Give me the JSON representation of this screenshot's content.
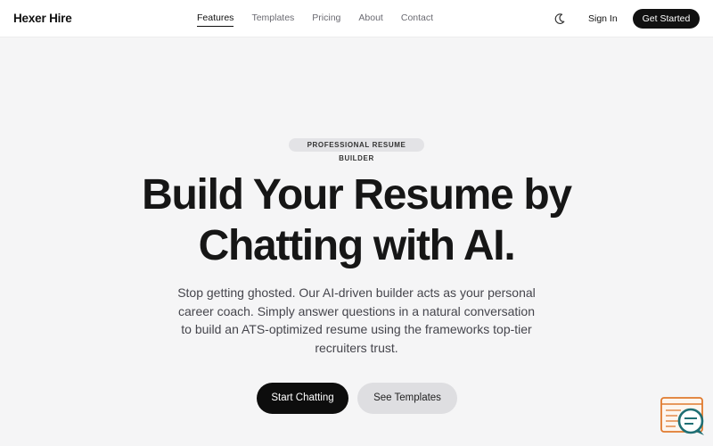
{
  "nav": {
    "brand": "Hexer Hire",
    "links": [
      "Features",
      "Templates",
      "Pricing",
      "About",
      "Contact"
    ],
    "active_link": "Features",
    "theme_icon": "moon-icon",
    "sign_in": "Sign In",
    "get_started": "Get Started"
  },
  "hero": {
    "badge": "PROFESSIONAL RESUME BUILDER",
    "headline_line1": "Build Your Resume by",
    "headline_line2": "Chatting with AI.",
    "subtext": "Stop getting ghosted. Our AI-driven builder acts as your personal career coach. Simply answer questions in a natural conversation to build an ATS-optimized resume using the frameworks top-tier recruiters trust.",
    "primary_cta": "Start Chatting",
    "secondary_cta": "See Templates"
  },
  "widget": {
    "icon": "resume-chat-icon",
    "accent_color": "#e07a2e",
    "bubble_color": "#1f6f74"
  }
}
